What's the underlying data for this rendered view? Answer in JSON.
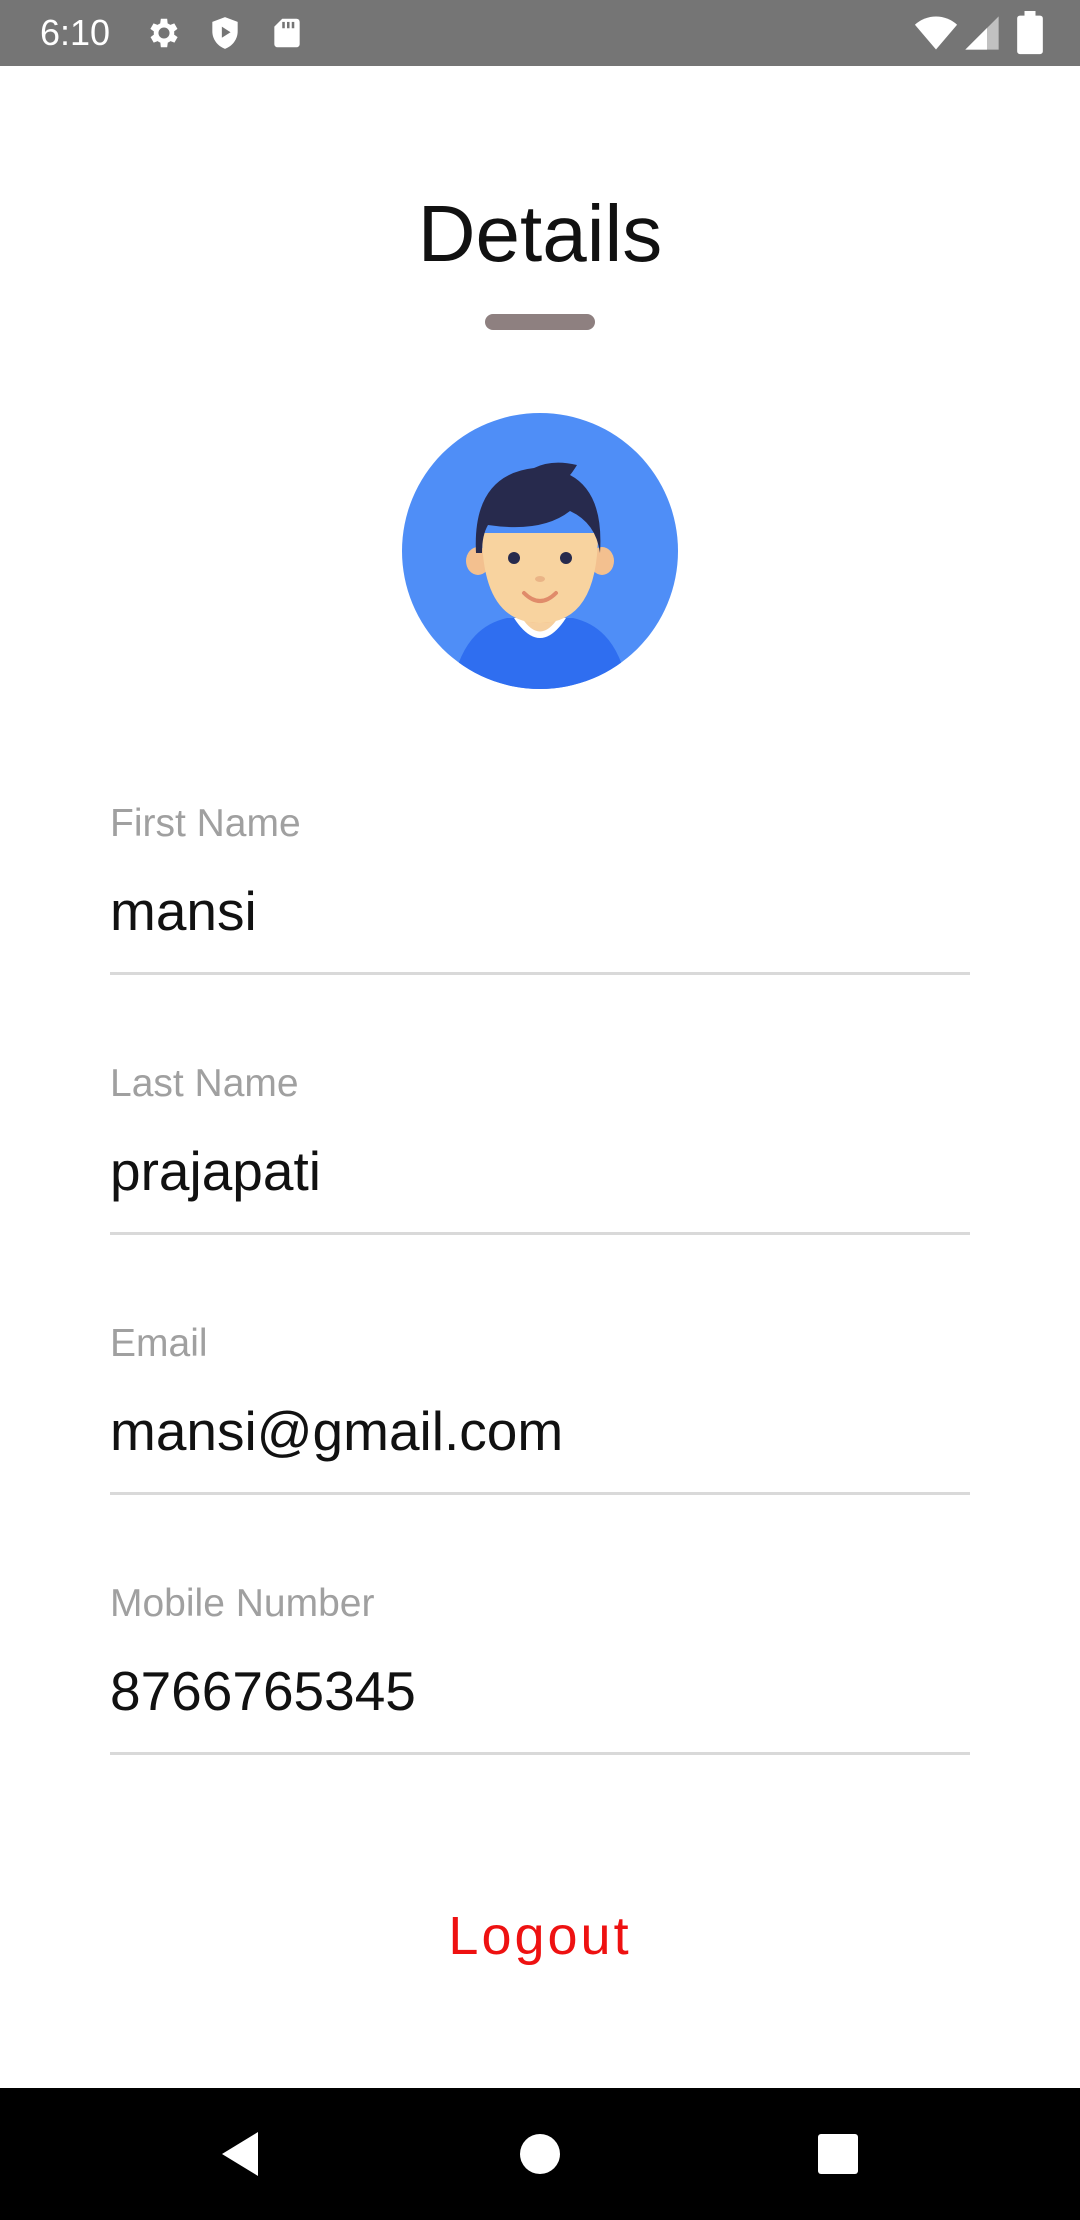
{
  "status_bar": {
    "time": "6:10",
    "icons_left": [
      "gear-icon",
      "shield-play-icon",
      "sd-card-icon"
    ],
    "icons_right": [
      "wifi-icon",
      "cell-signal-icon",
      "battery-icon"
    ]
  },
  "header": {
    "title": "Details"
  },
  "avatar": {
    "icon": "user-avatar-icon",
    "background_color": "#4f8ef7"
  },
  "form": {
    "first_name": {
      "label": "First Name",
      "value": "mansi"
    },
    "last_name": {
      "label": "Last Name",
      "value": "prajapati"
    },
    "email": {
      "label": "Email",
      "value": "mansi@gmail.com"
    },
    "mobile": {
      "label": "Mobile Number",
      "value": "8766765345"
    }
  },
  "actions": {
    "logout_label": "Logout",
    "logout_color": "#ee1111"
  },
  "nav_bar": {
    "buttons": [
      "back-icon",
      "home-icon",
      "recents-icon"
    ]
  }
}
